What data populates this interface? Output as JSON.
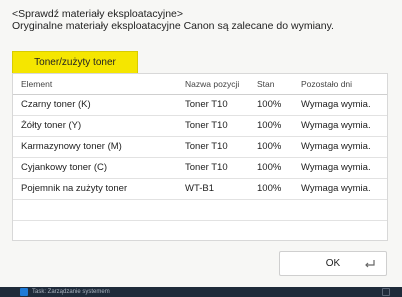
{
  "header": {
    "line1": "<Sprawdź materiały eksploatacyjne>",
    "line2": "Oryginalne materiały eksploatacyjne Canon są zalecane do wymiany."
  },
  "tab": {
    "label": "Toner/zużyty toner"
  },
  "table": {
    "headers": [
      "Element",
      "Nazwa pozycji",
      "Stan",
      "Pozostało dni"
    ],
    "rows": [
      [
        "Czarny toner (K)",
        "Toner T10",
        "100%",
        "Wymaga wymia."
      ],
      [
        "Żółty toner (Y)",
        "Toner T10",
        "100%",
        "Wymaga wymia."
      ],
      [
        "Karmazynowy toner (M)",
        "Toner T10",
        "100%",
        "Wymaga wymia."
      ],
      [
        "Cyjankowy toner (C)",
        "Toner T10",
        "100%",
        "Wymaga wymia."
      ],
      [
        "Pojemnik na zużyty toner",
        "WT-B1",
        "100%",
        "Wymaga wymia."
      ]
    ]
  },
  "ok_button": {
    "label": "OK",
    "icon": "return-icon"
  },
  "statusbar": {
    "text": "Task: Zarządzanie systemem",
    "icon": "status-icon"
  }
}
